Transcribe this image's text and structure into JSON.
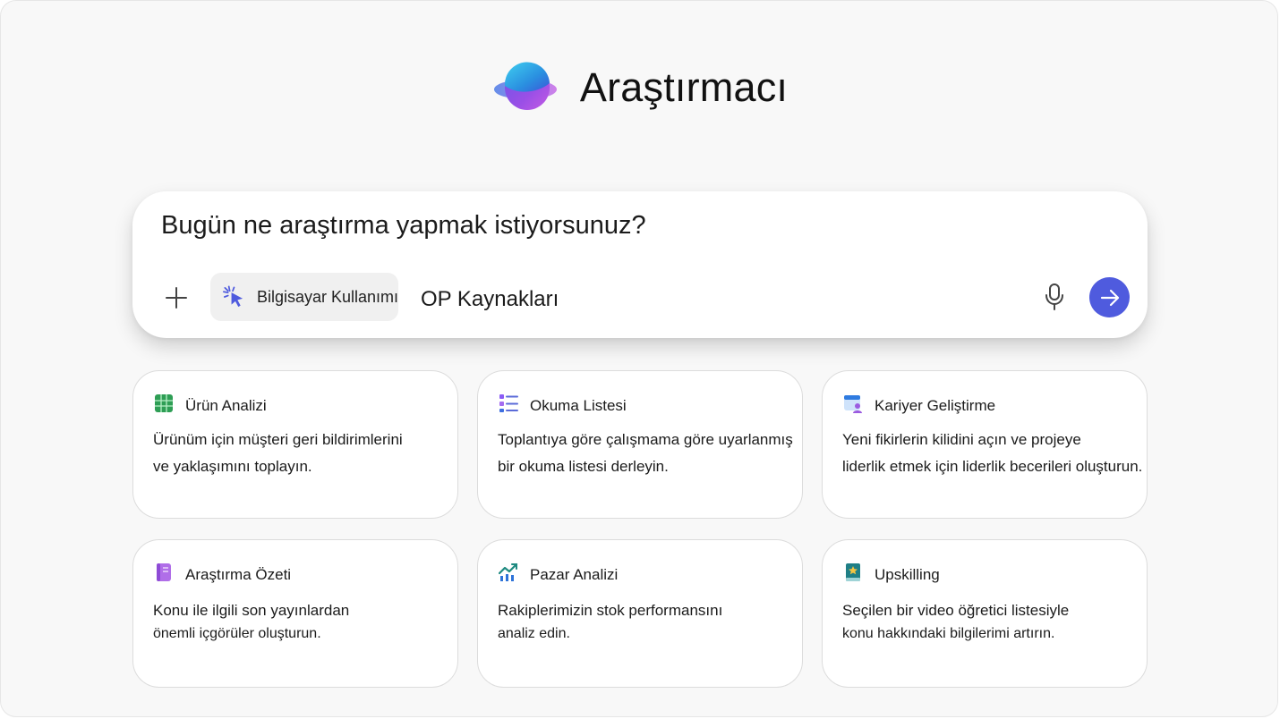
{
  "app": {
    "title": "Araştırmacı",
    "logo_icon": "planet-logo-icon"
  },
  "composer": {
    "prompt": "Bugün ne araştırma yapmak istiyorsunuz?",
    "chips": [
      {
        "label": "Bilgisayar Kullanımı",
        "icon": "pointer-click-icon",
        "selected": true
      },
      {
        "label": "OP Kaynakları"
      }
    ],
    "send_color": "#4f5bde"
  },
  "cards": [
    {
      "title": "Ürün Analizi",
      "icon": "spreadsheet-icon",
      "line1": "Ürünüm için müşteri geri bildirimlerini",
      "line2": "ve yaklaşımını toplayın."
    },
    {
      "title": "Okuma Listesi",
      "icon": "list-icon",
      "line1": "Toplantıya göre çalışmama göre uyarlanmış",
      "line2": "bir okuma listesi derleyin."
    },
    {
      "title": "Kariyer Geliştirme",
      "icon": "calendar-person-icon",
      "line1": "Yeni fikirlerin kilidini açın ve projeye",
      "line2": "liderlik etmek için liderlik becerileri oluşturun."
    },
    {
      "title": "Araştırma Özeti",
      "icon": "notebook-icon",
      "line1": "Konu ile ilgili son yayınlardan",
      "line2": "önemli içgörüler oluşturun."
    },
    {
      "title": "Pazar Analizi",
      "icon": "trend-chart-icon",
      "line1": "Rakiplerimizin stok performansını",
      "line2": "analiz edin."
    },
    {
      "title": "Upskilling",
      "icon": "book-star-icon",
      "line1": "Seçilen bir video öğretici listesiyle",
      "line2": "konu hakkındaki bilgilerimi artırın."
    }
  ]
}
